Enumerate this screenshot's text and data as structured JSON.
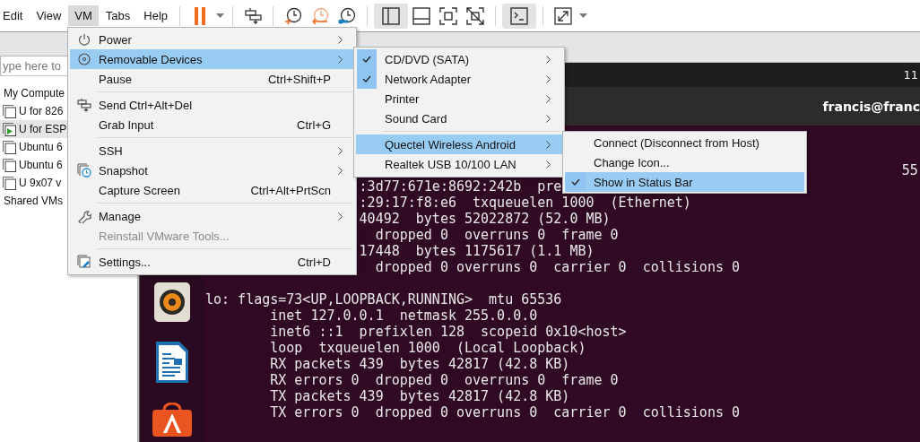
{
  "menu_bar": [
    {
      "label": "Edit",
      "selected": false
    },
    {
      "label": "View",
      "selected": false
    },
    {
      "label": "VM",
      "selected": true
    },
    {
      "label": "Tabs",
      "selected": false
    },
    {
      "label": "Help",
      "selected": false
    }
  ],
  "toolbar": {
    "groups": [
      [
        {
          "kind": "pause",
          "pressed": false
        },
        {
          "kind": "caret",
          "pressed": false
        }
      ],
      [
        {
          "kind": "send-keys",
          "pressed": false
        }
      ],
      [
        {
          "kind": "snapshot-take",
          "pressed": false
        },
        {
          "kind": "snapshot-revert",
          "pressed": false
        },
        {
          "kind": "snapshot-manager",
          "pressed": false
        }
      ],
      [
        {
          "kind": "view-library",
          "pressed": true
        },
        {
          "kind": "view-thumbnail",
          "pressed": false
        },
        {
          "kind": "view-fullscreen",
          "pressed": false
        },
        {
          "kind": "view-unity",
          "pressed": false
        }
      ],
      [
        {
          "kind": "console",
          "pressed": true
        }
      ],
      [
        {
          "kind": "fullscreen",
          "pressed": false
        },
        {
          "kind": "caret",
          "pressed": false
        }
      ]
    ]
  },
  "library": {
    "search": {
      "placeholder": "ype here to"
    },
    "tree": [
      {
        "label": "My Compute",
        "children": [
          {
            "label": "U for 826",
            "selected": false,
            "running": false
          },
          {
            "label": "U for ESP",
            "selected": true,
            "running": true
          },
          {
            "label": "Ubuntu 6",
            "selected": false,
            "running": false
          },
          {
            "label": "Ubuntu 6",
            "selected": false,
            "running": false
          },
          {
            "label": "U 9x07 v",
            "selected": false,
            "running": false
          }
        ]
      },
      {
        "label": "Shared VMs"
      }
    ]
  },
  "vm": {
    "top_bar_text": "11",
    "title": "francis@franc",
    "dock": [
      {
        "kind": "speaker"
      },
      {
        "kind": "writer"
      },
      {
        "kind": "store"
      }
    ],
    "terminal_blocks": [
      [
        "                                                                                      55",
        "                   :3d77:671e:8692:242b  pre",
        "                   :29:17:f8:e6  txqueuelen 1000  (Ethernet)",
        "                   40492  bytes 52022872 (52.0 MB)",
        "                     dropped 0  overruns 0  frame 0",
        "                   17448  bytes 1175617 (1.1 MB)",
        "                     dropped 0 overruns 0  carrier 0  collisions 0"
      ],
      [
        "lo: flags=73<UP,LOOPBACK,RUNNING>  mtu 65536",
        "        inet 127.0.0.1  netmask 255.0.0.0",
        "        inet6 ::1  prefixlen 128  scopeid 0x10<host>",
        "        loop  txqueuelen 1000  (Local Loopback)",
        "        RX packets 439  bytes 42817 (42.8 KB)",
        "        RX errors 0  dropped 0  overruns 0  frame 0",
        "        TX packets 439  bytes 42817 (42.8 KB)",
        "        TX errors 0  dropped 0 overruns 0  carrier 0  collisions 0"
      ]
    ]
  },
  "menus": [
    {
      "items": [
        {
          "label": "Power",
          "submenu": true,
          "selected": false,
          "disabled": false
        },
        {
          "label": "Removable Devices",
          "submenu": true,
          "selected": true,
          "disabled": false
        },
        {
          "label": "Pause",
          "shortcut": "Ctrl+Shift+P",
          "submenu": false,
          "selected": false,
          "disabled": false
        },
        {
          "kind": "separator"
        },
        {
          "label": "Send Ctrl+Alt+Del",
          "submenu": false,
          "selected": false,
          "disabled": false
        },
        {
          "label": "Grab Input",
          "shortcut": "Ctrl+G",
          "submenu": false,
          "selected": false,
          "disabled": false
        },
        {
          "kind": "separator"
        },
        {
          "label": "SSH",
          "submenu": true,
          "selected": false,
          "disabled": false
        },
        {
          "label": "Snapshot",
          "submenu": true,
          "selected": false,
          "disabled": false
        },
        {
          "label": "Capture Screen",
          "shortcut": "Ctrl+Alt+PrtScn",
          "submenu": false,
          "selected": false,
          "disabled": false
        },
        {
          "kind": "separator"
        },
        {
          "label": "Manage",
          "submenu": true,
          "selected": false,
          "disabled": false
        },
        {
          "label": "Reinstall VMware Tools...",
          "submenu": false,
          "selected": false,
          "disabled": true
        },
        {
          "kind": "separator"
        },
        {
          "label": "Settings...",
          "shortcut": "Ctrl+D",
          "submenu": false,
          "selected": false,
          "disabled": false
        }
      ]
    },
    {
      "items": [
        {
          "label": "CD/DVD (SATA)",
          "checked": true,
          "submenu": true,
          "selected": false
        },
        {
          "label": "Network Adapter",
          "checked": true,
          "submenu": true,
          "selected": false
        },
        {
          "label": "Printer",
          "checked": false,
          "submenu": true,
          "selected": false
        },
        {
          "label": "Sound Card",
          "checked": false,
          "submenu": true,
          "selected": false
        },
        {
          "kind": "separator"
        },
        {
          "label": "Quectel Wireless Android",
          "checked": false,
          "submenu": true,
          "selected": true
        },
        {
          "label": "Realtek USB 10/100 LAN",
          "checked": false,
          "submenu": true,
          "selected": false
        }
      ]
    },
    {
      "items": [
        {
          "label": "Connect (Disconnect from Host)",
          "checked": false,
          "submenu": false,
          "selected": false
        },
        {
          "label": "Change Icon...",
          "checked": false,
          "submenu": false,
          "selected": false
        },
        {
          "label": "Show in Status Bar",
          "checked": true,
          "submenu": false,
          "selected": true
        }
      ]
    }
  ]
}
